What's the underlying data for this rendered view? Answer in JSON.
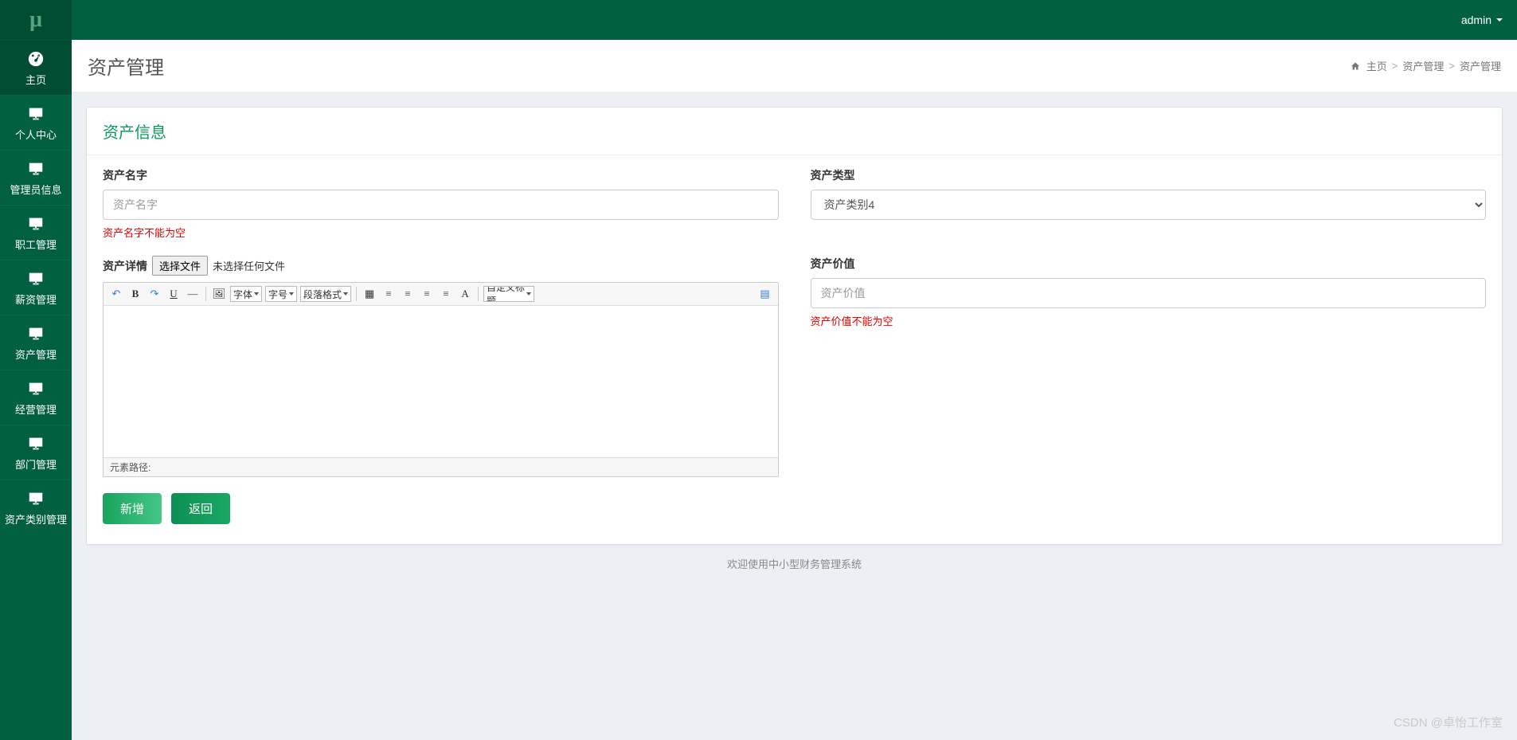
{
  "logo": "μ",
  "user": {
    "name": "admin"
  },
  "sidebar": {
    "items": [
      {
        "label": "主页",
        "icon": "dashboard"
      },
      {
        "label": "个人中心",
        "icon": "monitor"
      },
      {
        "label": "管理员信息",
        "icon": "monitor"
      },
      {
        "label": "职工管理",
        "icon": "monitor"
      },
      {
        "label": "薪资管理",
        "icon": "monitor"
      },
      {
        "label": "资产管理",
        "icon": "monitor"
      },
      {
        "label": "经营管理",
        "icon": "monitor"
      },
      {
        "label": "部门管理",
        "icon": "monitor"
      },
      {
        "label": "资产类别管理",
        "icon": "monitor"
      }
    ]
  },
  "header": {
    "title": "资产管理",
    "breadcrumb": {
      "home": "主页",
      "parent": "资产管理",
      "current": "资产管理"
    }
  },
  "panel": {
    "title": "资产信息"
  },
  "form": {
    "name": {
      "label": "资产名字",
      "placeholder": "资产名字",
      "error": "资产名字不能为空"
    },
    "type": {
      "label": "资产类型",
      "selected": "资产类别4"
    },
    "detail": {
      "label": "资产详情",
      "file_button": "选择文件",
      "file_status": "未选择任何文件"
    },
    "value": {
      "label": "资产价值",
      "placeholder": "资产价值",
      "error": "资产价值不能为空"
    }
  },
  "editor": {
    "font_family": "字体",
    "font_size": "字号",
    "para_format": "段落格式",
    "custom_title": "自定义标题",
    "footer": "元素路径:"
  },
  "buttons": {
    "add": "新增",
    "back": "返回"
  },
  "footer": "欢迎使用中小型财务管理系统",
  "watermark": "CSDN @卓怡工作室"
}
